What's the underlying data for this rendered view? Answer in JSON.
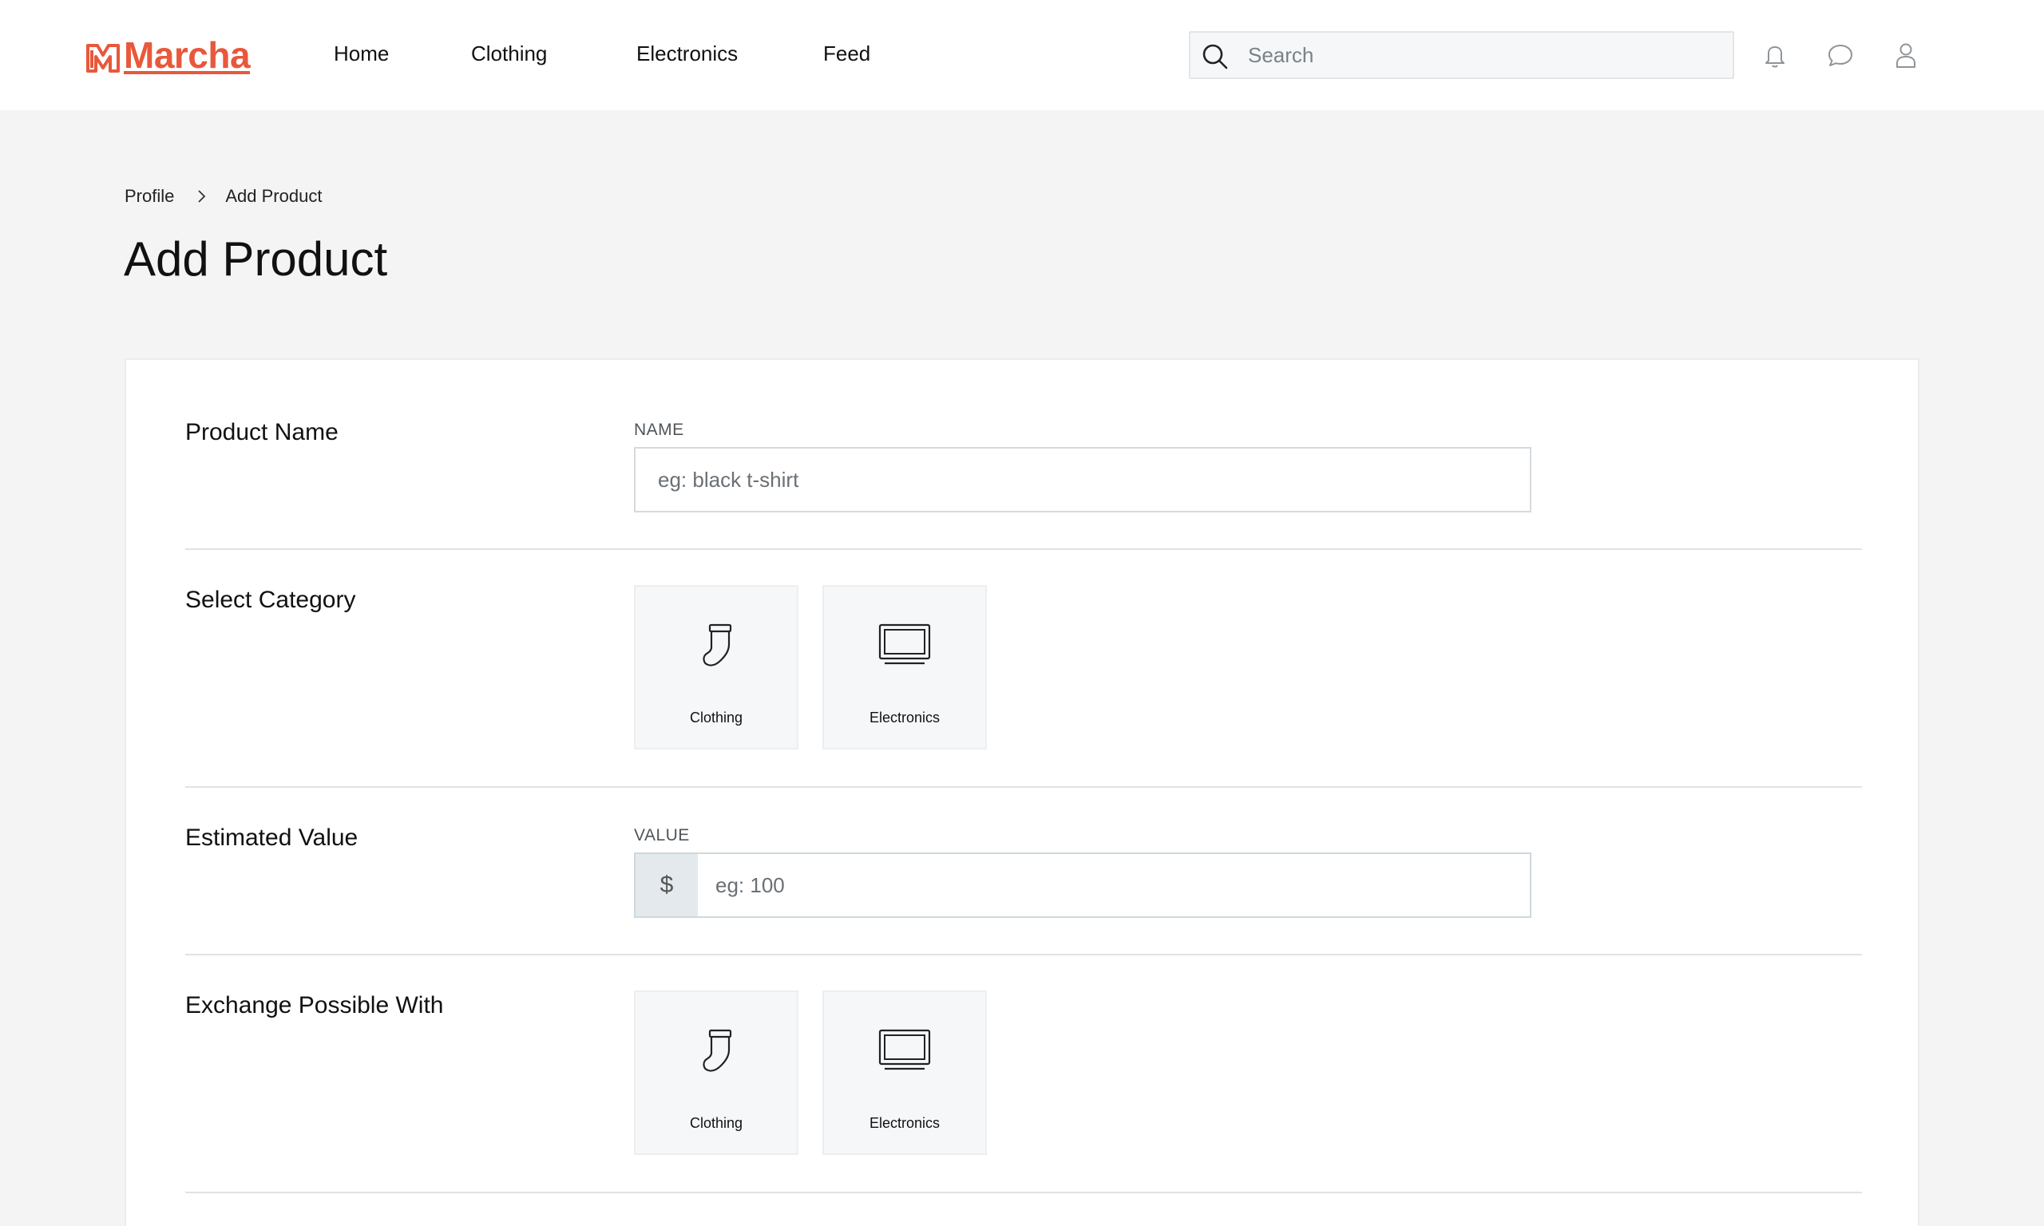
{
  "brand": {
    "name": "Marcha",
    "color": "#e8583b"
  },
  "nav": {
    "items": [
      {
        "label": "Home"
      },
      {
        "label": "Clothing"
      },
      {
        "label": "Electronics"
      },
      {
        "label": "Feed"
      }
    ]
  },
  "search": {
    "placeholder": "Search",
    "icon": "search-icon"
  },
  "header_icons": [
    "bell-icon",
    "chat-bubble-icon",
    "user-icon"
  ],
  "breadcrumb": {
    "parent": "Profile",
    "current": "Add Product"
  },
  "page": {
    "title": "Add Product"
  },
  "form": {
    "product_name": {
      "label": "Product Name",
      "caption": "NAME",
      "placeholder": "eg: black t-shirt",
      "value": ""
    },
    "category": {
      "label": "Select Category",
      "options": [
        {
          "label": "Clothing",
          "icon": "sock-icon"
        },
        {
          "label": "Electronics",
          "icon": "laptop-icon"
        }
      ]
    },
    "estimated_value": {
      "label": "Estimated Value",
      "caption": "VALUE",
      "prefix": "$",
      "placeholder": "eg: 100",
      "value": ""
    },
    "exchange": {
      "label": "Exchange Possible With",
      "options": [
        {
          "label": "Clothing",
          "icon": "sock-icon"
        },
        {
          "label": "Electronics",
          "icon": "laptop-icon"
        }
      ]
    }
  }
}
